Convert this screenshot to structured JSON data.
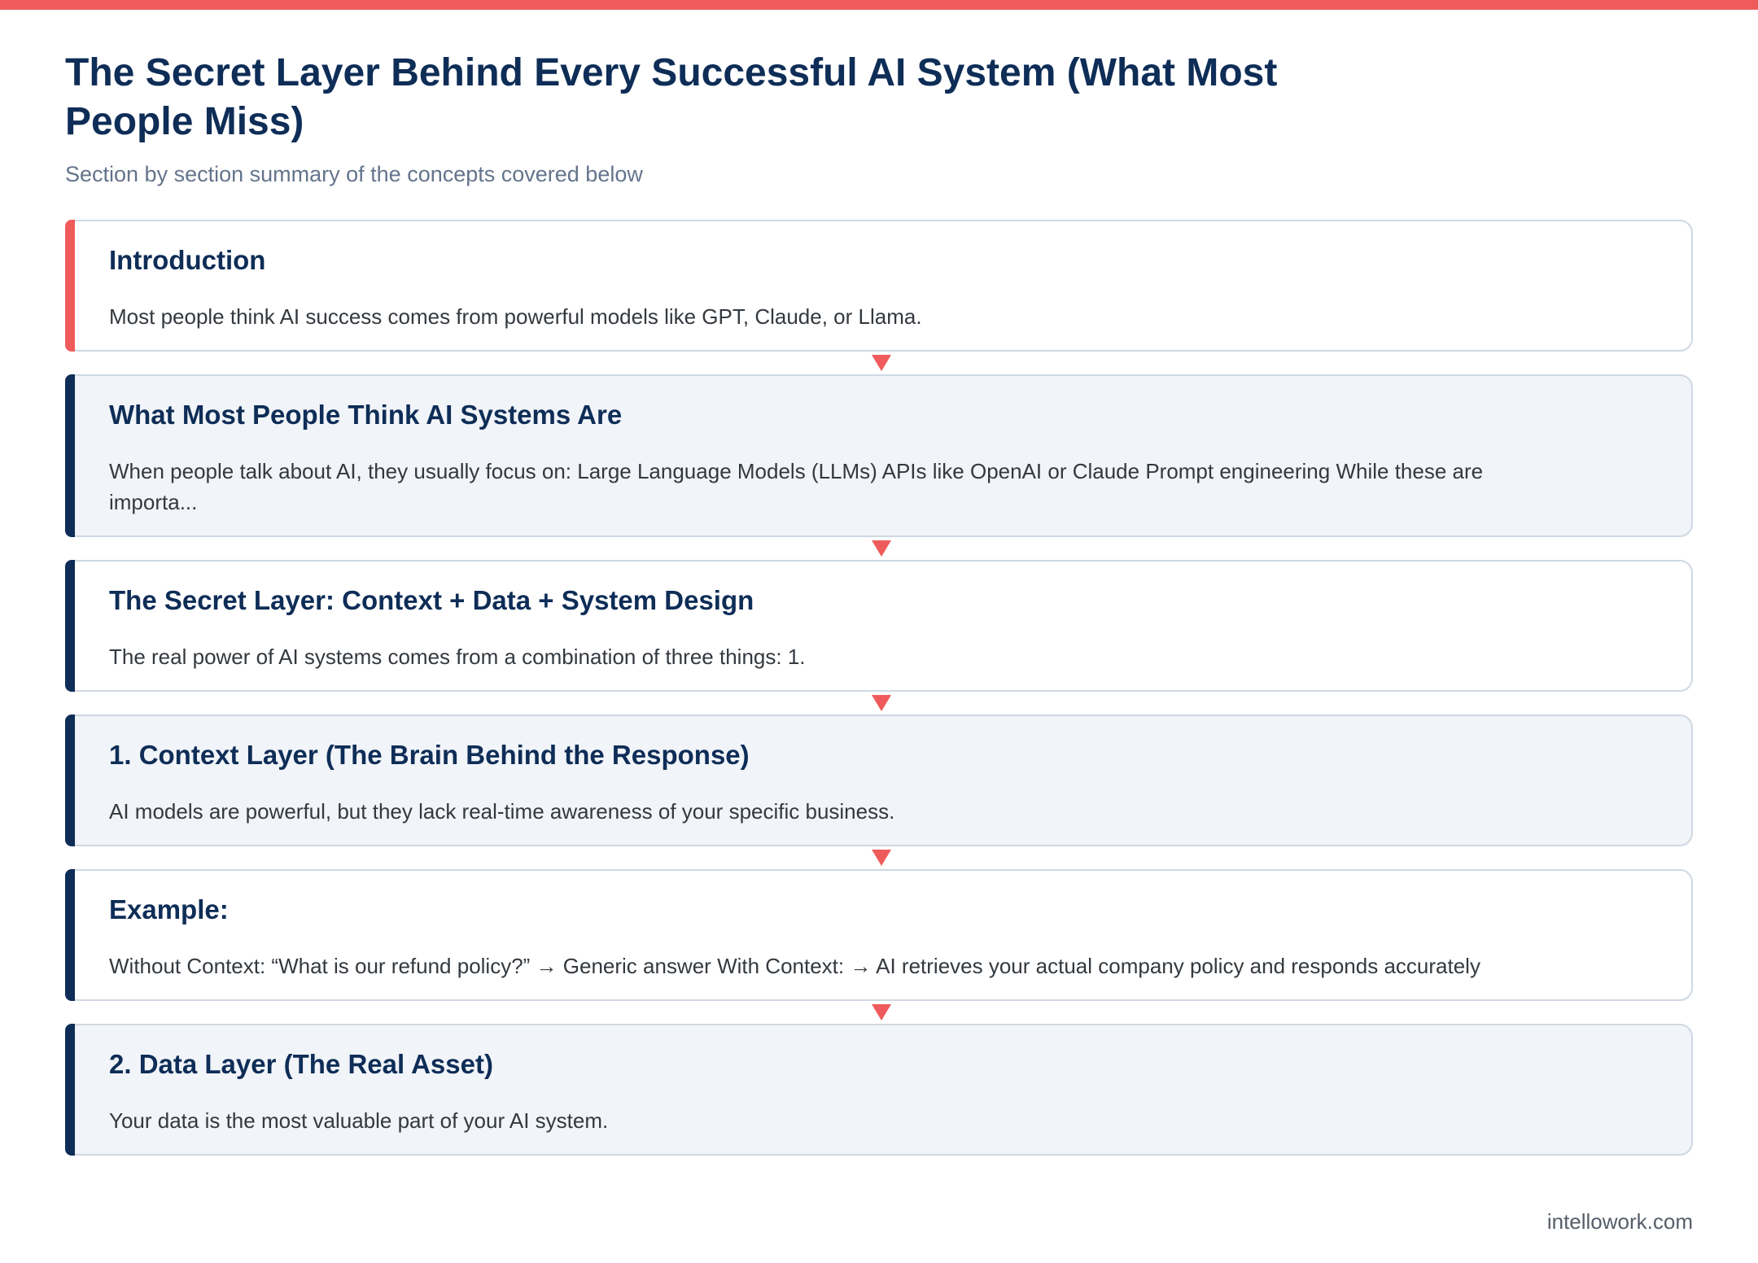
{
  "header": {
    "title": "The Secret Layer Behind Every Successful AI System (What Most People Miss)",
    "subtitle": "Section by section summary of the concepts covered below"
  },
  "colors": {
    "accent_red": "#ef5b5b",
    "navy": "#0e2d57"
  },
  "sections": [
    {
      "title": "Introduction",
      "text": "Most people think AI success comes from powerful models like GPT, Claude, or Llama."
    },
    {
      "title": "What Most People Think AI Systems Are",
      "text": "When people talk about AI, they usually focus on: Large Language Models (LLMs) APIs like OpenAI or Claude Prompt engineering While these are importa..."
    },
    {
      "title": "The Secret Layer: Context + Data + System Design",
      "text": "The real power of AI systems comes from a combination of three things: 1."
    },
    {
      "title": "1. Context Layer (The Brain Behind the Response)",
      "text": "AI models are powerful, but they lack real-time awareness of your specific business."
    },
    {
      "title": "Example:",
      "text": "Without Context: “What is our refund policy?” → Generic answer With Context: → AI retrieves your actual company policy and responds accurately"
    },
    {
      "title": "2. Data Layer (The Real Asset)",
      "text": "Your data is the most valuable part of your AI system."
    }
  ],
  "footer": {
    "site": "intellowork.com"
  }
}
